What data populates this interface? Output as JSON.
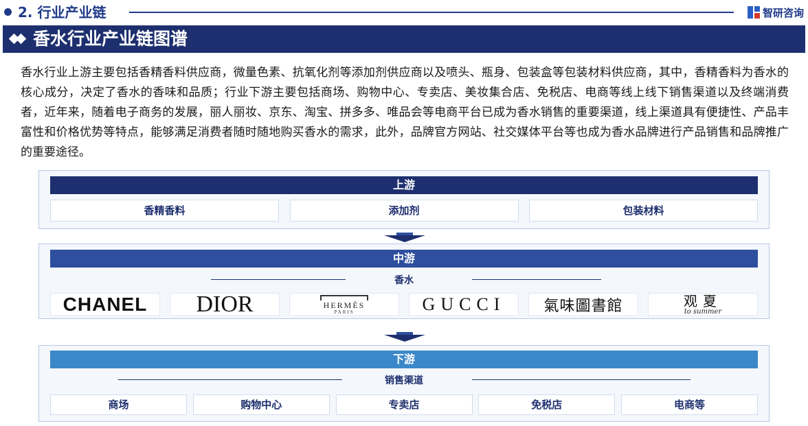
{
  "header": {
    "section_title": "2. 行业产业链",
    "brand_name": "智研咨询",
    "brand_icon": "zhiyan-logo-icon"
  },
  "banner": {
    "title": "香水行业产业链图谱",
    "icon": "double-diamond-icon"
  },
  "intro": "香水行业上游主要包括香精香料供应商，微量色素、抗氧化剂等添加剂供应商以及喷头、瓶身、包装盒等包装材料供应商，其中，香精香料为香水的核心成分，决定了香水的香味和品质；行业下游主要包括商场、购物中心、专卖店、美妆集合店、免税店、电商等线上线下销售渠道以及终端消费者，近年来，随着电子商务的发展，丽人丽妆、京东、淘宝、拼多多、唯品会等电商平台已成为香水销售的重要渠道，线上渠道具有便捷性、产品丰富性和价格优势等特点，能够满足消费者随时随地购买香水的需求，此外，品牌官方网站、社交媒体平台等也成为香水品牌进行产品销售和品牌推广的重要途径。",
  "upstream": {
    "title": "上游",
    "items": [
      "香精香料",
      "添加剂",
      "包装材料"
    ]
  },
  "midstream": {
    "title": "中游",
    "label": "香水",
    "brands": {
      "chanel": "CHANEL",
      "dior": "DIOR",
      "hermes_main": "HERMÈS",
      "hermes_sub": "PARIS",
      "gucci": "GUCCI",
      "wwtsg": "氣味圖書館",
      "guanxia_main": "观夏",
      "guanxia_sub": "to summer"
    }
  },
  "downstream": {
    "title": "下游",
    "label": "销售渠道",
    "items": [
      "商场",
      "购物中心",
      "专卖店",
      "免税店",
      "电商等"
    ]
  },
  "colors": {
    "navy": "#1d2f6e",
    "mid_blue": "#2d4f9e",
    "light_blue": "#3a88c9",
    "panel_bg": "#f4f7fc"
  }
}
